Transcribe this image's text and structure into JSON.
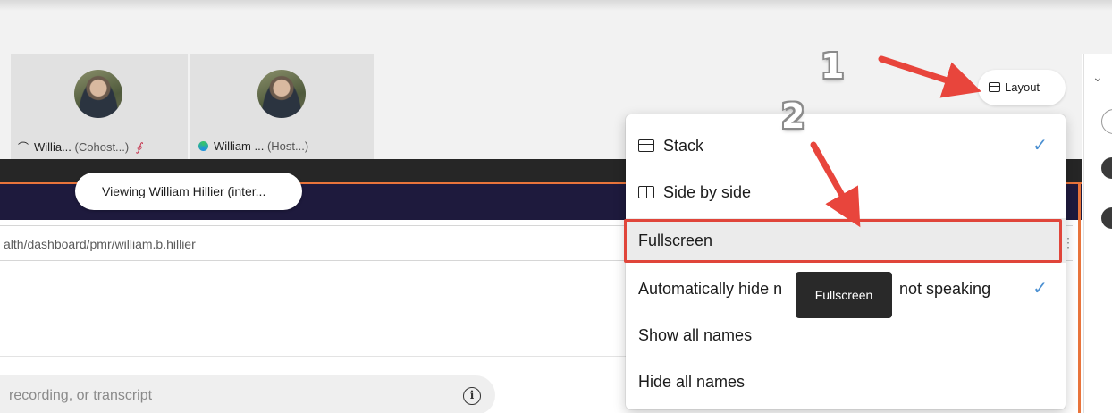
{
  "participants": [
    {
      "name": "Willia...",
      "role": "(Cohost...)",
      "mute_icon": "mic-off-icon",
      "status_icon": "headset-icon"
    },
    {
      "name": "William ...",
      "role": "(Host...)",
      "status_icon": "status-dot-icon"
    }
  ],
  "share_banner": {
    "text": "Viewing William Hillier (inter..."
  },
  "browser": {
    "url": "alth/dashboard/pmr/william.b.hillier"
  },
  "search": {
    "placeholder": "recording, or transcript"
  },
  "layout_button": {
    "label": "Layout",
    "icon": "layout-icon"
  },
  "layout_menu": {
    "items": [
      {
        "label": "Stack",
        "icon": "stack-layout-icon",
        "checked": true
      },
      {
        "label": "Side by side",
        "icon": "side-by-side-icon",
        "checked": false
      },
      {
        "label": "Fullscreen",
        "checked": false,
        "highlighted": true
      },
      {
        "label": "Automatically hide n",
        "label_suffix": "not speaking",
        "checked": true
      },
      {
        "label": "Show all names",
        "checked": false
      },
      {
        "label": "Hide all names",
        "checked": false
      }
    ],
    "check_glyph": "✓"
  },
  "tooltip": {
    "text": "Fullscreen"
  },
  "annotations": {
    "step1": "1",
    "step2": "2",
    "arrow_color": "#e8453c",
    "box_color": "#e0453a"
  },
  "colors": {
    "accent_orange": "#e8743b",
    "navy": "#1e1a3d",
    "check_blue": "#4a8fd1"
  }
}
